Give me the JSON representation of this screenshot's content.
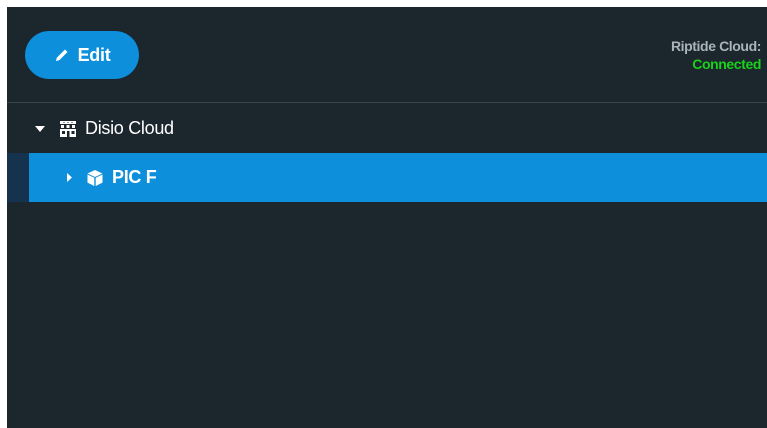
{
  "header": {
    "edit_label": "Edit",
    "status_label": "Riptide Cloud:",
    "status_value": "Connected"
  },
  "tree": {
    "root": {
      "label": "Disio Cloud",
      "expanded": true,
      "icon": "building-icon"
    },
    "children": [
      {
        "label": "PIC F",
        "expanded": false,
        "selected": true,
        "icon": "cube-icon"
      }
    ]
  },
  "colors": {
    "panel_bg": "#1b262d",
    "accent": "#0d8fdb",
    "connected": "#19d11a",
    "muted_text": "#aab3b9"
  }
}
